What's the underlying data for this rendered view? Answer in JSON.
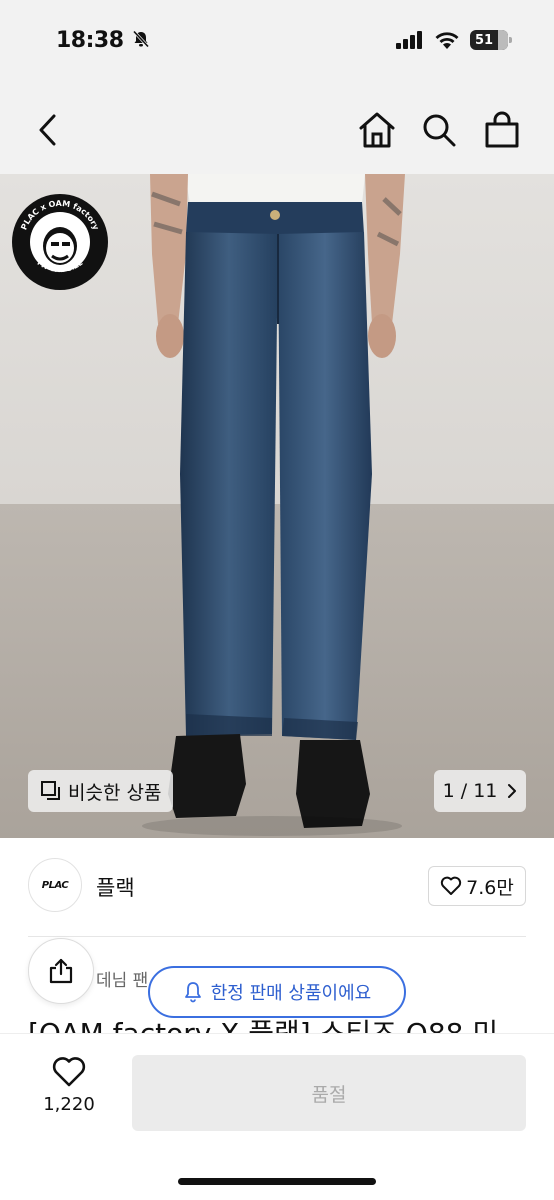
{
  "status_bar": {
    "time": "18:38",
    "battery": "51",
    "icons": [
      "bell-slash-icon",
      "signal-icon",
      "wifi-icon",
      "battery-icon"
    ]
  },
  "nav": {
    "icons": [
      "back-chevron-icon",
      "home-icon",
      "search-icon",
      "shopping-bag-icon"
    ]
  },
  "hero": {
    "similar_label": "비슷한 상품",
    "badge_text_top": "PLAC x OAM factory",
    "badge_text_right": "FIT THE SIZE",
    "page_counter": "1 / 11"
  },
  "brand": {
    "logo_text": "PLAC",
    "name": "플랙",
    "like_count": "7.6만"
  },
  "product": {
    "category": "데님 팬",
    "title": "[OAM factory X 플랙] 스티즈 O88 미",
    "limited_notice": "한정 판매 상품이에요"
  },
  "bottom_bar": {
    "wish_count": "1,220",
    "cta_label": "품절"
  },
  "colors": {
    "accent": "#3b6fe0",
    "disabled_bg": "#ebebeb",
    "disabled_text": "#aaaaaa"
  }
}
